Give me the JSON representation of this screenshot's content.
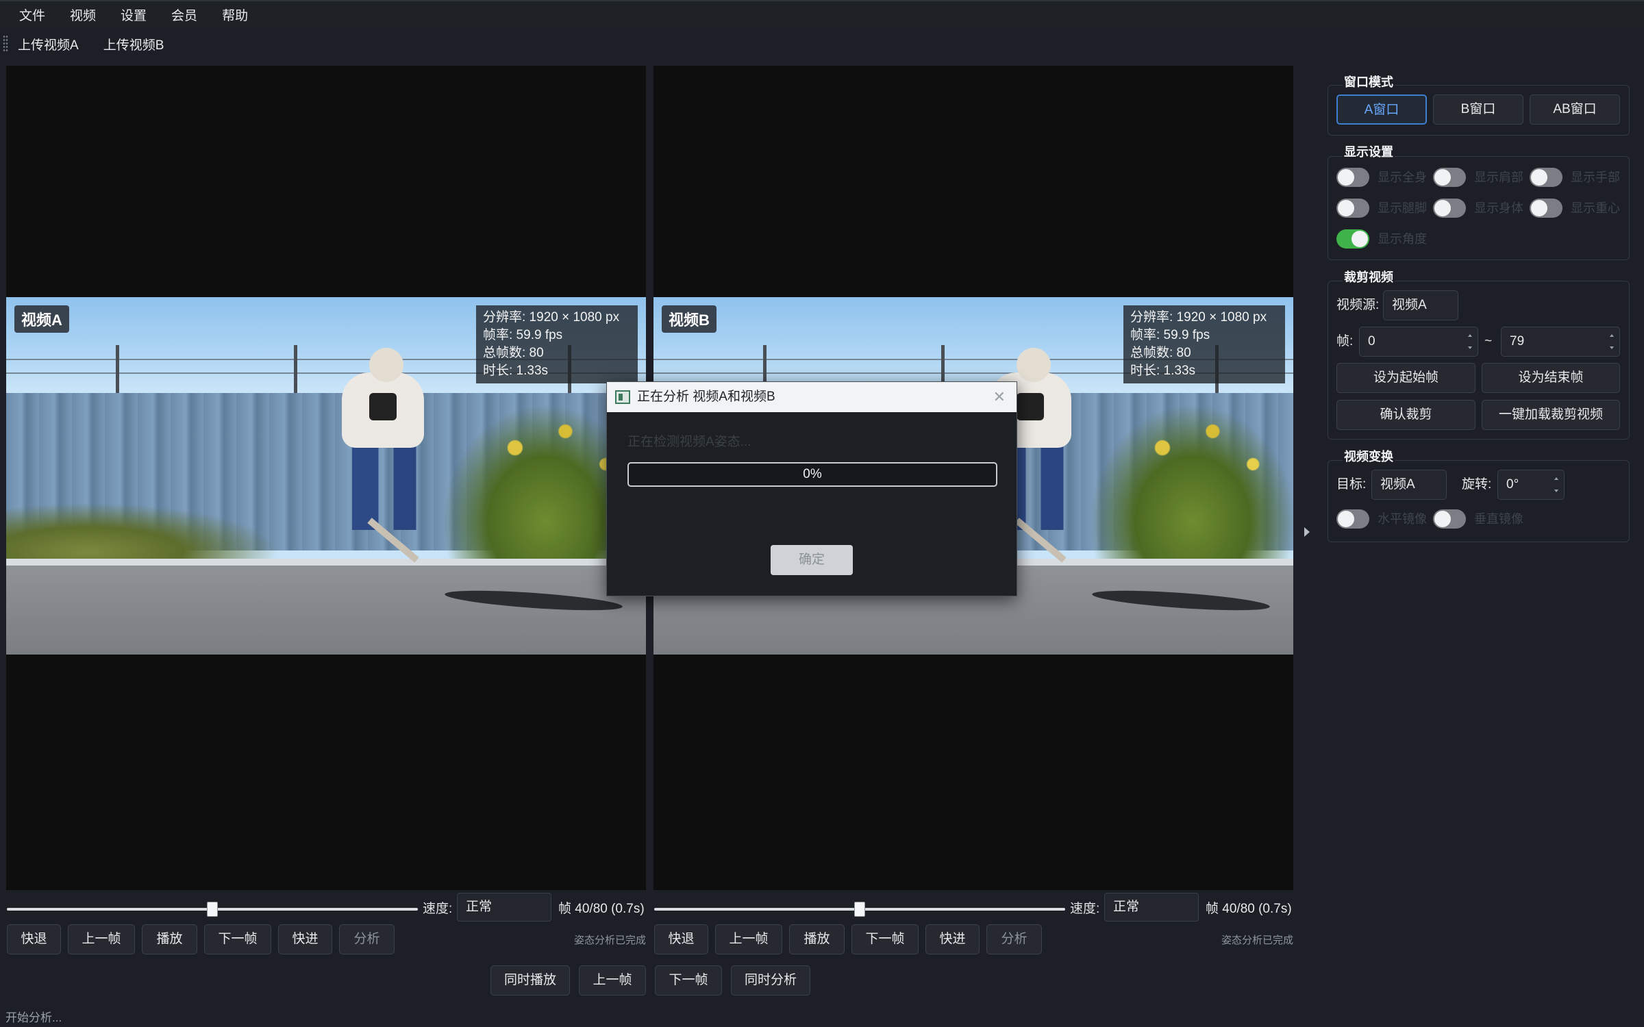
{
  "menu": [
    "文件",
    "视频",
    "设置",
    "会员",
    "帮助"
  ],
  "toolbar": [
    "上传视频A",
    "上传视频B"
  ],
  "video_a": {
    "label": "视频A",
    "info": [
      "分辨率: 1920 × 1080 px",
      "帧率: 59.9 fps",
      "总帧数: 80",
      "时长: 1.33s"
    ],
    "speed_label": "速度:",
    "speed_value": "正常",
    "frame_count": "帧 40/80  (0.7s)",
    "progress": 0.5,
    "controls": [
      "快退",
      "上一帧",
      "播放",
      "下一帧",
      "快进",
      "分析"
    ],
    "status": "姿态分析已完成"
  },
  "video_b": {
    "label": "视频B",
    "info": [
      "分辨率: 1920 × 1080 px",
      "帧率: 59.9 fps",
      "总帧数: 80",
      "时长: 1.33s"
    ],
    "speed_label": "速度:",
    "speed_value": "正常",
    "frame_count": "帧 40/80  (0.7s)",
    "progress": 0.5,
    "controls": [
      "快退",
      "上一帧",
      "播放",
      "下一帧",
      "快进",
      "分析"
    ],
    "status": "姿态分析已完成"
  },
  "sync_controls": [
    "同时播放",
    "上一帧",
    "下一帧",
    "同时分析"
  ],
  "statusbar": "开始分析...",
  "panel": {
    "window_mode": {
      "title": "窗口模式",
      "buttons": [
        "A窗口",
        "B窗口",
        "AB窗口"
      ],
      "selected": "A窗口"
    },
    "display": {
      "title": "显示设置",
      "toggles": [
        {
          "label": "显示全身",
          "on": false
        },
        {
          "label": "显示肩部",
          "on": false
        },
        {
          "label": "显示手部",
          "on": false
        },
        {
          "label": "显示腿脚",
          "on": false
        },
        {
          "label": "显示身体",
          "on": false
        },
        {
          "label": "显示重心",
          "on": false
        },
        {
          "label": "显示角度",
          "on": true
        }
      ]
    },
    "crop": {
      "title": "裁剪视频",
      "source_label": "视频源:",
      "source_value": "视频A",
      "frame_label": "帧:",
      "start": "0",
      "range_sep": "~",
      "end": "79",
      "buttons": [
        "设为起始帧",
        "设为结束帧",
        "确认裁剪",
        "一键加载裁剪视频"
      ]
    },
    "transform": {
      "title": "视频变换",
      "target_label": "目标:",
      "target_value": "视频A",
      "rotate_label": "旋转:",
      "rotate_value": "0°",
      "toggles": [
        {
          "label": "水平镜像",
          "on": false
        },
        {
          "label": "垂直镜像",
          "on": false
        }
      ]
    }
  },
  "dialog": {
    "title": "正在分析 视频A和视频B",
    "message": "正在检测视频A姿态...",
    "progress_text": "0%",
    "ok": "确定"
  }
}
